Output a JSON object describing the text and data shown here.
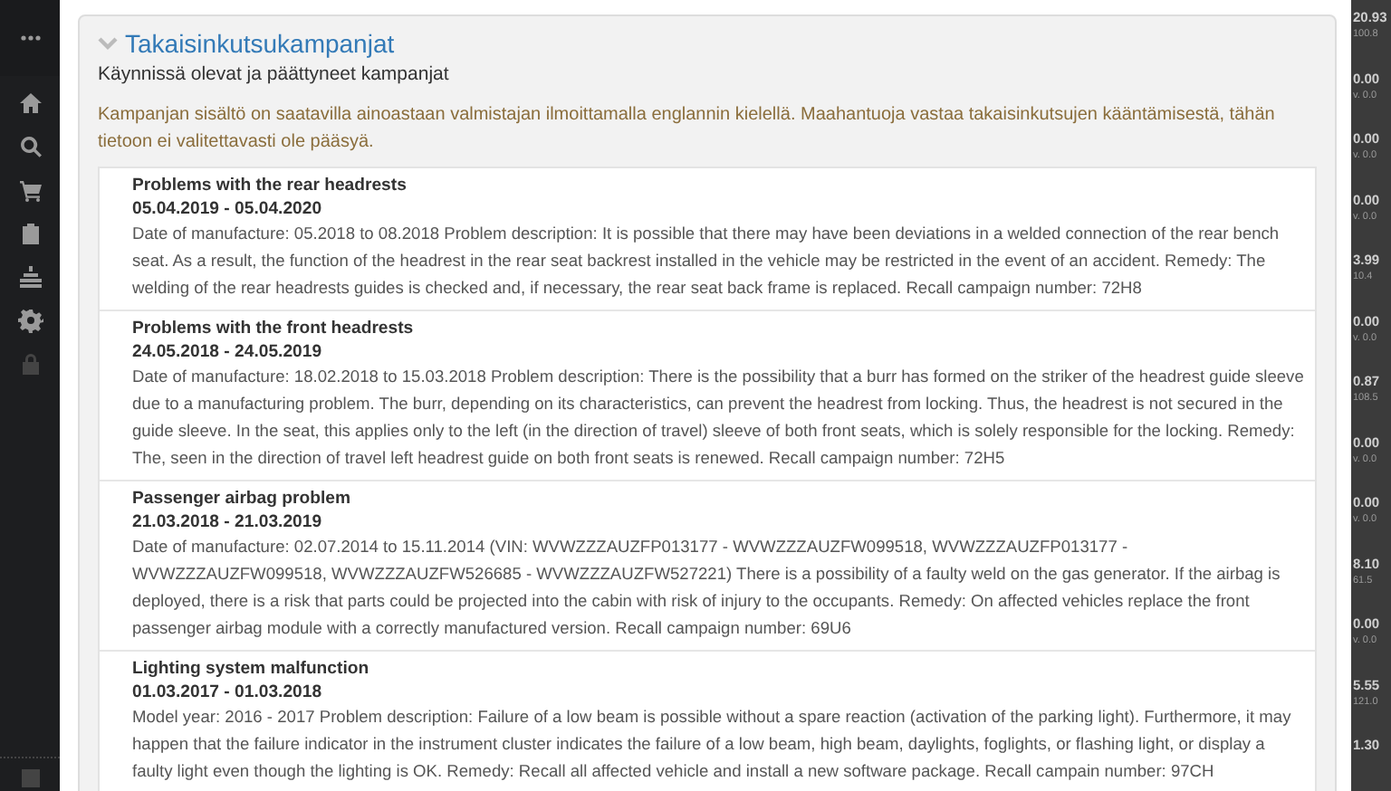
{
  "sidebar": {
    "items": [
      {
        "kind": "more"
      },
      {
        "kind": "home"
      },
      {
        "kind": "search"
      },
      {
        "kind": "cart"
      },
      {
        "kind": "clipboard"
      },
      {
        "kind": "stack"
      },
      {
        "kind": "gear"
      },
      {
        "kind": "lock"
      }
    ],
    "footer_item": {
      "kind": "box"
    }
  },
  "panel": {
    "title": "Takaisinkutsukampanjat",
    "expanded": true,
    "subtitle": "Käynnissä olevat ja päättyneet kampanjat",
    "notice": "Kampanjan sisältö on saatavilla ainoastaan valmistajan ilmoittamalla englannin kielellä. Maahantuoja vastaa takaisinkutsujen kääntämisestä, tähän tietoon ei valitettavasti ole pääsyä.",
    "campaigns": [
      {
        "title": "Problems with the rear headrests",
        "dates": "05.04.2019 - 05.04.2020",
        "description": "Date of manufacture: 05.2018 to 08.2018 Problem description: It is possible that there may have been deviations in a welded connection of the rear bench seat. As a result, the function of the headrest in the rear seat backrest installed in the vehicle may be restricted in the event of an accident. Remedy: The welding of the rear headrests guides is checked and, if necessary, the rear seat back frame is replaced. Recall campaign number: 72H8"
      },
      {
        "title": "Problems with the front headrests",
        "dates": "24.05.2018 - 24.05.2019",
        "description": "Date of manufacture: 18.02.2018 to 15.03.2018 Problem description: There is the possibility that a burr has formed on the striker of the headrest guide sleeve due to a manufacturing problem. The burr, depending on its characteristics, can prevent the headrest from locking. Thus, the headrest is not secured in the guide sleeve. In the seat, this applies only to the left (in the direction of travel) sleeve of both front seats, which is solely responsible for the locking. Remedy: The, seen in the direction of travel left headrest guide on both front seats is renewed. Recall campaign number: 72H5"
      },
      {
        "title": "Passenger airbag problem",
        "dates": "21.03.2018 - 21.03.2019",
        "description": "Date of manufacture: 02.07.2014 to 15.11.2014 (VIN: WVWZZZAUZFP013177 - WVWZZZAUZFW099518, WVWZZZAUZFP013177 - WVWZZZAUZFW099518, WVWZZZAUZFW526685 - WVWZZZAUZFW527221) There is a possibility of a faulty weld on the gas generator. If the airbag is deployed, there is a risk that parts could be projected into the cabin with risk of injury to the occupants. Remedy: On affected vehicles replace the front passenger airbag module with a correctly manufactured version. Recall campaign number: 69U6"
      },
      {
        "title": "Lighting system malfunction",
        "dates": "01.03.2017 - 01.03.2018",
        "description": "Model year: 2016 - 2017 Problem description: Failure of a low beam is possible without a spare reaction (activation of the parking light). Furthermore, it may happen that the failure indicator in the instrument cluster indicates the failure of a low beam, high beam, daylights, foglights, or flashing light, or display a faulty light even though the lighting is OK. Remedy: Recall all affected vehicle and install a new software package. Recall campain number: 97CH"
      }
    ]
  },
  "background_column": [
    {
      "value": "20.93",
      "sub": "100.8"
    },
    {
      "value": "0.00",
      "sub": "v. 0.0"
    },
    {
      "value": "0.00",
      "sub": "v. 0.0"
    },
    {
      "value": "0.00",
      "sub": "v. 0.0"
    },
    {
      "value": "3.99",
      "sub": "10.4"
    },
    {
      "value": "0.00",
      "sub": "v. 0.0"
    },
    {
      "value": "0.87",
      "sub": "108.5"
    },
    {
      "value": "0.00",
      "sub": "v. 0.0"
    },
    {
      "value": "0.00",
      "sub": "v. 0.0"
    },
    {
      "value": "8.10",
      "sub": "61.5"
    },
    {
      "value": "0.00",
      "sub": "v. 0.0"
    },
    {
      "value": "5.55",
      "sub": "121.0"
    },
    {
      "value": "1.30"
    }
  ]
}
